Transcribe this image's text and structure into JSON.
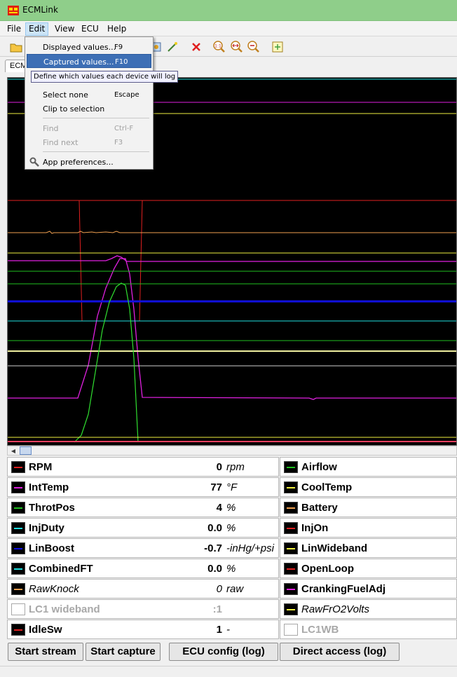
{
  "window": {
    "title": "ECMLink"
  },
  "menubar": {
    "items": [
      "File",
      "Edit",
      "View",
      "ECU",
      "Help"
    ]
  },
  "edit_menu": {
    "items": [
      {
        "label": "Displayed values...",
        "shortcut": "F9",
        "state": "normal"
      },
      {
        "label": "Captured values...",
        "shortcut": "F10",
        "state": "highlighted"
      },
      {
        "label": "Select none",
        "shortcut": "Escape",
        "state": "normal"
      },
      {
        "label": "Clip to selection",
        "shortcut": "",
        "state": "normal"
      },
      {
        "label": "Find",
        "shortcut": "Ctrl-F",
        "state": "disabled"
      },
      {
        "label": "Find next",
        "shortcut": "F3",
        "state": "disabled"
      },
      {
        "label": "App preferences...",
        "shortcut": "",
        "state": "normal"
      }
    ],
    "tooltip": "Define which values each device will log"
  },
  "tabs": [
    {
      "label": "ECM"
    }
  ],
  "colors": {
    "red": "#e02020",
    "magenta": "#e020e0",
    "green": "#20c020",
    "cyan": "#20e0e0",
    "blue": "#1010e0",
    "yellow": "#f0f040",
    "orange": "#f0a050",
    "pink": "#f07080"
  },
  "values": [
    {
      "name": "RPM",
      "value": "0",
      "unit": "rpm",
      "color": "#e02020",
      "style": "normal"
    },
    {
      "name": "Airflow",
      "value": "",
      "unit": "",
      "color": "#20c020",
      "style": "normal"
    },
    {
      "name": "IntTemp",
      "value": "77",
      "unit": "°F",
      "color": "#e020e0",
      "style": "normal"
    },
    {
      "name": "CoolTemp",
      "value": "",
      "unit": "",
      "color": "#f0f040",
      "style": "normal"
    },
    {
      "name": "ThrotPos",
      "value": "4",
      "unit": "%",
      "color": "#20c020",
      "style": "normal"
    },
    {
      "name": "Battery",
      "value": "",
      "unit": "",
      "color": "#f0a050",
      "style": "normal"
    },
    {
      "name": "InjDuty",
      "value": "0.0",
      "unit": "%",
      "color": "#20e0e0",
      "style": "normal"
    },
    {
      "name": "InjOn",
      "value": "",
      "unit": "",
      "color": "#e02020",
      "style": "normal"
    },
    {
      "name": "LinBoost",
      "value": "-0.7",
      "unit": "-inHg/+psi",
      "color": "#1010e0",
      "style": "normal"
    },
    {
      "name": "LinWideband",
      "value": "",
      "unit": "",
      "color": "#f0f040",
      "style": "normal"
    },
    {
      "name": "CombinedFT",
      "value": "0.0",
      "unit": "%",
      "color": "#20e0e0",
      "style": "normal"
    },
    {
      "name": "OpenLoop",
      "value": "",
      "unit": "",
      "color": "#e02020",
      "style": "normal"
    },
    {
      "name": "RawKnock",
      "value": "0",
      "unit": "raw",
      "color": "#f0a050",
      "style": "italic"
    },
    {
      "name": "CrankingFuelAdj",
      "value": "",
      "unit": "",
      "color": "#e020e0",
      "style": "normal"
    },
    {
      "name": "LC1 wideband",
      "value": ":1",
      "unit": "",
      "color": "",
      "style": "disabled"
    },
    {
      "name": "RawFrO2Volts",
      "value": "",
      "unit": "",
      "color": "#f0f040",
      "style": "italic"
    },
    {
      "name": "IdleSw",
      "value": "1",
      "unit": "-",
      "color": "#e02020",
      "style": "normal"
    },
    {
      "name": "LC1WB",
      "value": "",
      "unit": "",
      "color": "",
      "style": "disabled"
    }
  ],
  "buttons": {
    "start_stream": "Start stream",
    "start_capture": "Start capture",
    "ecu_config": "ECU config (log)",
    "direct_access": "Direct access (log)"
  },
  "toolbar": {
    "icons": [
      "open-folder-icon",
      "settings-icon",
      "wand-icon",
      "delete-icon",
      "zoom-actual-icon",
      "zoom-fit-icon",
      "zoom-out-icon",
      "export-icon"
    ]
  }
}
